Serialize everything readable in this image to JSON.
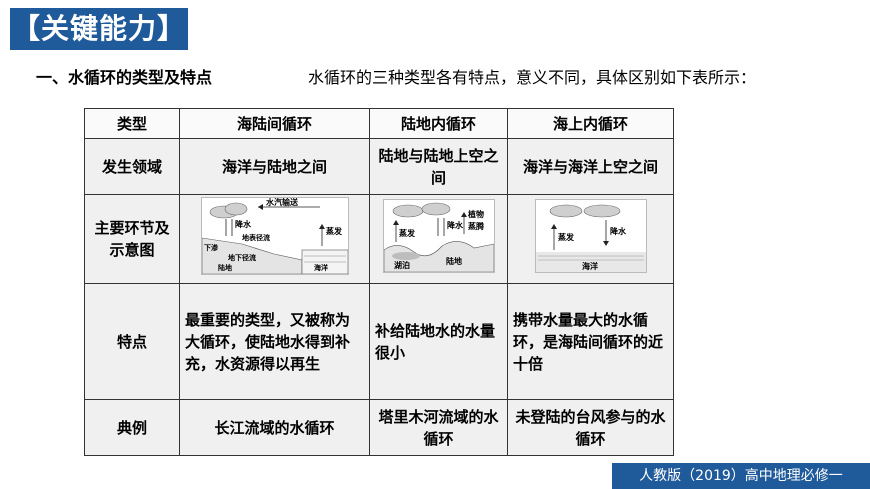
{
  "header": {
    "title": "【关键能力】",
    "section_heading": "一、水循环的类型及特点",
    "intro": "水循环的三种类型各有特点，意义不同，具体区别如下表所示："
  },
  "table": {
    "columns": [
      "类型",
      "海陆间循环",
      "陆地内循环",
      "海上内循环"
    ],
    "rows": [
      {
        "label": "发生领域",
        "cells": [
          "海洋与陆地之间",
          "陆地与陆地上空之间",
          "海洋与海洋上空之间"
        ]
      },
      {
        "label": "主要环节及示意图"
      },
      {
        "label": "特点",
        "cells": [
          "最重要的类型，又被称为大循环，使陆地水得到补充，水资源得以再生",
          "补给陆地水的水量很小",
          "携带水量最大的水循环，是海陆间循环的近十倍"
        ]
      },
      {
        "label": "典例",
        "cells": [
          "长江流域的水循环",
          "塔里木河流域的水循环",
          "未登陆的台风参与的水循环"
        ]
      }
    ]
  },
  "diagrams": {
    "sea_land": {
      "labels": [
        "水汽输送",
        "降水",
        "地表径流",
        "下渗",
        "地下径流",
        "蒸发",
        "海洋",
        "陆地"
      ]
    },
    "land": {
      "labels": [
        "植物",
        "蒸腾",
        "降水",
        "蒸发",
        "湖泊",
        "陆地"
      ]
    },
    "ocean": {
      "labels": [
        "蒸发",
        "降水",
        "海洋"
      ]
    }
  },
  "footer": {
    "text": "人教版（2019）高中地理必修一"
  },
  "colors": {
    "accent": "#1f5a9b",
    "cell_bg": "#f0f0f0"
  }
}
